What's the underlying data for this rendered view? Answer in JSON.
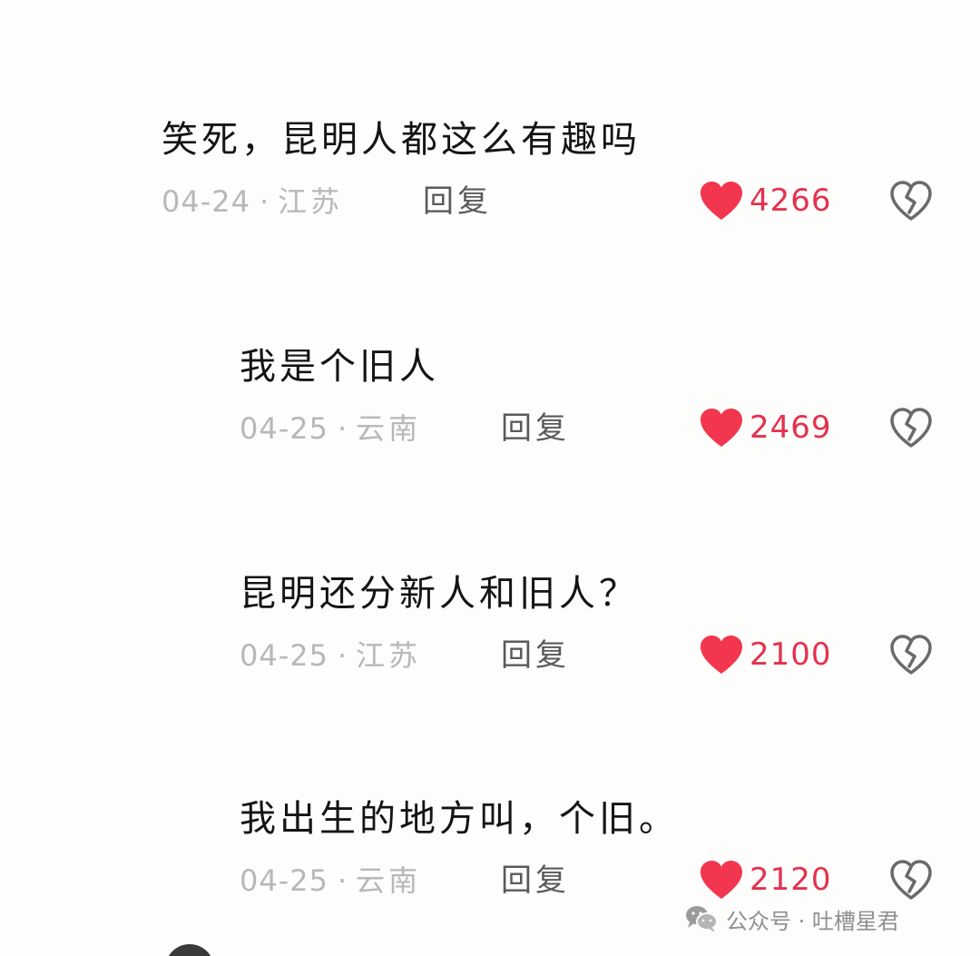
{
  "comments": [
    {
      "text": "笑死，昆明人都这么有趣吗",
      "date": "04-24",
      "separator": "·",
      "location": "江苏",
      "reply_label": "回复",
      "likes": "4266"
    },
    {
      "text": "我是个旧人",
      "date": "04-25",
      "separator": "·",
      "location": "云南",
      "reply_label": "回复",
      "likes": "2469"
    },
    {
      "text": "昆明还分新人和旧人？",
      "date": "04-25",
      "separator": "·",
      "location": "江苏",
      "reply_label": "回复",
      "likes": "2100"
    },
    {
      "text": "我出生的地方叫，个旧。",
      "date": "04-25",
      "separator": "·",
      "location": "云南",
      "reply_label": "回复",
      "likes": "2120"
    }
  ],
  "watermark": {
    "label": "公众号 · 吐槽星君",
    "icon": "wechat-icon"
  },
  "icons": {
    "like": "heart-icon",
    "dislike": "broken-heart-icon"
  },
  "colors": {
    "like": "#f2364f",
    "like_text": "#e4314f",
    "meta": "#b8b8b8",
    "reply": "#5a5a5a",
    "text": "#141414"
  }
}
